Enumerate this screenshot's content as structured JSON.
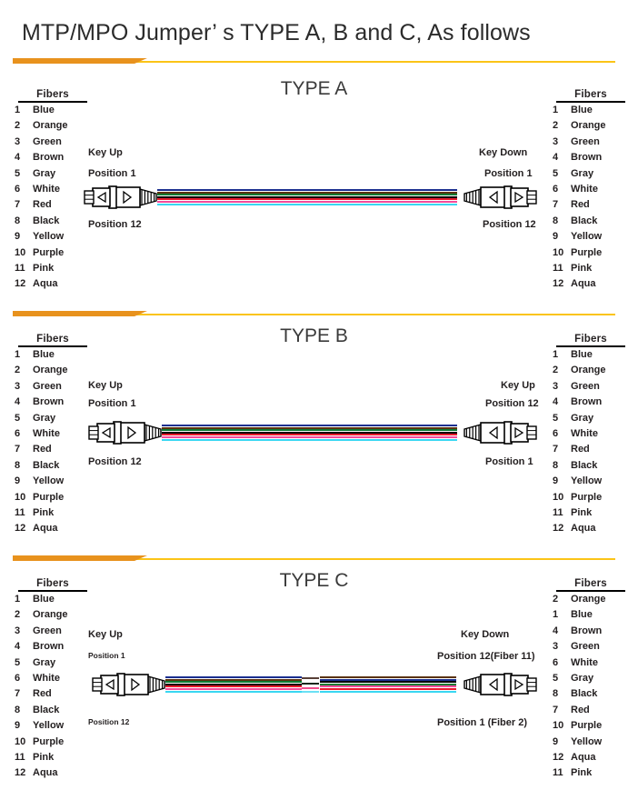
{
  "title": "MTP/MPO Jumper’ s TYPE A, B and C, As follows",
  "colors": {
    "divider_orange": "#e8921d",
    "divider_yellow": "#fbc417",
    "text": "#231f20",
    "heading": "#3a3a3a"
  },
  "fiber_palette": {
    "Blue": "#1b2f8f",
    "Orange": "#d96a12",
    "Green": "#0a7a33",
    "Brown": "#5a3310",
    "Gray": "#9a9a9a",
    "White": "#ffffff",
    "Red": "#e8192c",
    "Black": "#000000",
    "Yellow": "#f2e400",
    "Purple": "#6b2f8f",
    "Pink": "#f24b9b",
    "Aqua": "#39d7f2"
  },
  "legend_header": "Fibers",
  "sections": [
    {
      "id": "type-a",
      "heading": "TYPE A",
      "left_legend": [
        {
          "num": "1",
          "name": "Blue"
        },
        {
          "num": "2",
          "name": "Orange"
        },
        {
          "num": "3",
          "name": "Green"
        },
        {
          "num": "4",
          "name": "Brown"
        },
        {
          "num": "5",
          "name": "Gray"
        },
        {
          "num": "6",
          "name": "White"
        },
        {
          "num": "7",
          "name": "Red"
        },
        {
          "num": "8",
          "name": "Black"
        },
        {
          "num": "9",
          "name": "Yellow"
        },
        {
          "num": "10",
          "name": "Purple"
        },
        {
          "num": "11",
          "name": "Pink"
        },
        {
          "num": "12",
          "name": "Aqua"
        }
      ],
      "right_legend": [
        {
          "num": "1",
          "name": "Blue"
        },
        {
          "num": "2",
          "name": "Orange"
        },
        {
          "num": "3",
          "name": "Green"
        },
        {
          "num": "4",
          "name": "Brown"
        },
        {
          "num": "5",
          "name": "Gray"
        },
        {
          "num": "6",
          "name": "White"
        },
        {
          "num": "7",
          "name": "Red"
        },
        {
          "num": "8",
          "name": "Black"
        },
        {
          "num": "9",
          "name": "Yellow"
        },
        {
          "num": "10",
          "name": "Purple"
        },
        {
          "num": "11",
          "name": "Pink"
        },
        {
          "num": "12",
          "name": "Aqua"
        }
      ],
      "left_connector": {
        "key_label": "Key Up",
        "top_position": "Position 1",
        "bottom_position": "Position 12"
      },
      "right_connector": {
        "key_label": "Key Down",
        "top_position": "Position 1",
        "bottom_position": "Position 12"
      },
      "crossover": false
    },
    {
      "id": "type-b",
      "heading": "TYPE B",
      "left_legend": [
        {
          "num": "1",
          "name": "Blue"
        },
        {
          "num": "2",
          "name": "Orange"
        },
        {
          "num": "3",
          "name": "Green"
        },
        {
          "num": "4",
          "name": "Brown"
        },
        {
          "num": "5",
          "name": "Gray"
        },
        {
          "num": "6",
          "name": "White"
        },
        {
          "num": "7",
          "name": "Red"
        },
        {
          "num": "8",
          "name": "Black"
        },
        {
          "num": "9",
          "name": "Yellow"
        },
        {
          "num": "10",
          "name": "Purple"
        },
        {
          "num": "11",
          "name": "Pink"
        },
        {
          "num": "12",
          "name": "Aqua"
        }
      ],
      "right_legend": [
        {
          "num": "1",
          "name": "Blue"
        },
        {
          "num": "2",
          "name": "Orange"
        },
        {
          "num": "3",
          "name": "Green"
        },
        {
          "num": "4",
          "name": "Brown"
        },
        {
          "num": "5",
          "name": "Gray"
        },
        {
          "num": "6",
          "name": "White"
        },
        {
          "num": "7",
          "name": "Red"
        },
        {
          "num": "8",
          "name": "Black"
        },
        {
          "num": "9",
          "name": "Yellow"
        },
        {
          "num": "10",
          "name": "Purple"
        },
        {
          "num": "11",
          "name": "Pink"
        },
        {
          "num": "12",
          "name": "Aqua"
        }
      ],
      "left_connector": {
        "key_label": "Key Up",
        "top_position": "Position 1",
        "bottom_position": "Position 12"
      },
      "right_connector": {
        "key_label": "Key Up",
        "top_position": "Position 12",
        "bottom_position": "Position 1"
      },
      "crossover": false
    },
    {
      "id": "type-c",
      "heading": "TYPE C",
      "left_legend": [
        {
          "num": "1",
          "name": "Blue"
        },
        {
          "num": "2",
          "name": "Orange"
        },
        {
          "num": "3",
          "name": "Green"
        },
        {
          "num": "4",
          "name": "Brown"
        },
        {
          "num": "5",
          "name": "Gray"
        },
        {
          "num": "6",
          "name": "White"
        },
        {
          "num": "7",
          "name": "Red"
        },
        {
          "num": "8",
          "name": "Black"
        },
        {
          "num": "9",
          "name": "Yellow"
        },
        {
          "num": "10",
          "name": "Purple"
        },
        {
          "num": "11",
          "name": "Pink"
        },
        {
          "num": "12",
          "name": "Aqua"
        }
      ],
      "right_legend": [
        {
          "num": "2",
          "name": "Orange"
        },
        {
          "num": "1",
          "name": "Blue"
        },
        {
          "num": "4",
          "name": "Brown"
        },
        {
          "num": "3",
          "name": "Green"
        },
        {
          "num": "6",
          "name": "White"
        },
        {
          "num": "5",
          "name": "Gray"
        },
        {
          "num": "8",
          "name": "Black"
        },
        {
          "num": "7",
          "name": "Red"
        },
        {
          "num": "10",
          "name": "Purple"
        },
        {
          "num": "9",
          "name": "Yellow"
        },
        {
          "num": "12",
          "name": "Aqua"
        },
        {
          "num": "11",
          "name": "Pink"
        }
      ],
      "left_connector": {
        "key_label": "Key Up",
        "top_position": "Position 1",
        "bottom_position": "Position 12"
      },
      "right_connector": {
        "key_label": "Key Down",
        "top_position": "Position 12(Fiber 11)",
        "bottom_position": "Position 1 (Fiber 2)"
      },
      "crossover": true
    }
  ]
}
